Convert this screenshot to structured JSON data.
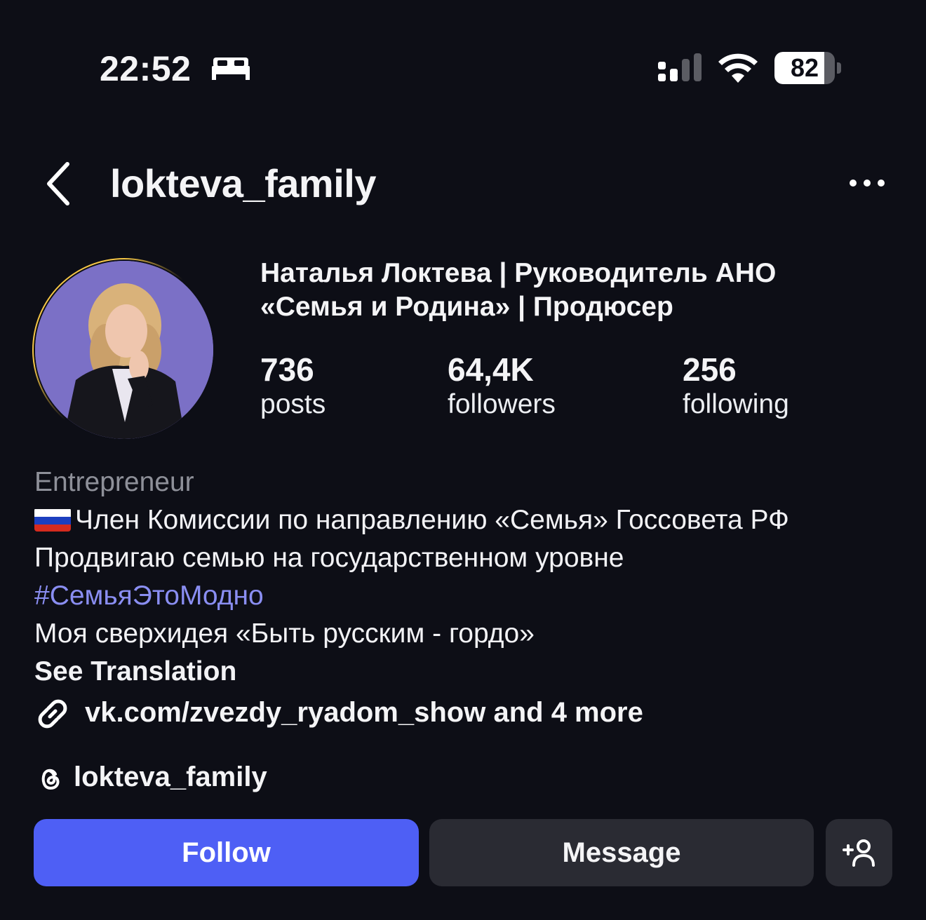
{
  "status_bar": {
    "time": "22:52",
    "battery_level": "82",
    "battery_fraction": 0.82,
    "icons": [
      "bed-icon",
      "cellular-signal-icon",
      "wifi-icon",
      "battery-icon"
    ]
  },
  "header": {
    "username": "lokteva_family",
    "icons": [
      "back-chevron-icon",
      "more-options-icon"
    ]
  },
  "profile": {
    "full_name_line1": "Наталья Локтева | Руководитель АНО",
    "full_name_line2": "«Семья и Родина» | Продюсер",
    "stats": [
      {
        "value": "736",
        "label": "posts"
      },
      {
        "value": "64,4K",
        "label": "followers"
      },
      {
        "value": "256",
        "label": "following"
      }
    ],
    "category": "Entrepreneur",
    "bio": {
      "line1": "Член Комиссии по направлению «Семья» Госсовета РФ",
      "line2": "Продвигаю семью на государственном уровне",
      "hashtag": "#СемьяЭтоМодно",
      "line4": "Моя сверхидея «Быть русским - гордо»",
      "see_translation": "See Translation"
    },
    "link_text": "vk.com/zvezdy_ryadom_show and 4 more",
    "threads_handle": "lokteva_family",
    "avatar_ring_color": "#f6c746",
    "avatar_bg_color": "#7b70c6"
  },
  "actions": {
    "follow_label": "Follow",
    "message_label": "Message",
    "follow_color": "#4e5ff5",
    "icons": [
      "add-person-icon"
    ]
  }
}
